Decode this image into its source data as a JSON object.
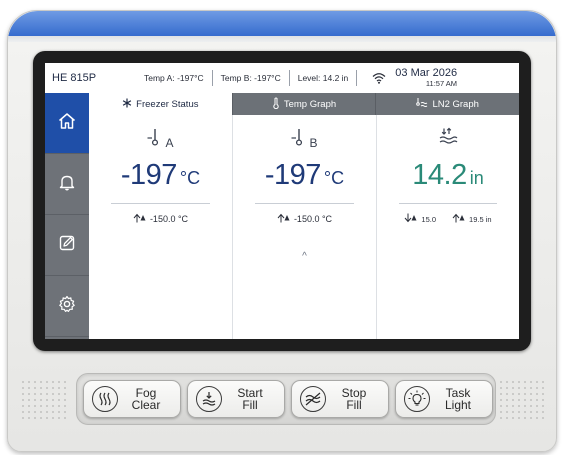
{
  "status_bar": {
    "model": "HE 815P",
    "temp_a": "Temp A: -197°C",
    "temp_b": "Temp B: -197°C",
    "level": "Level: 14.2 in",
    "date": "03 Mar 2026",
    "time": "11:57 AM"
  },
  "sidebar": {
    "items": [
      {
        "icon": "home-icon",
        "active": true
      },
      {
        "icon": "bell-icon",
        "active": false
      },
      {
        "icon": "edit-icon",
        "active": false
      },
      {
        "icon": "gear-icon",
        "active": false
      }
    ]
  },
  "tabs": [
    {
      "label": "Freezer Status",
      "icon": "snowflake-icon",
      "active": true
    },
    {
      "label": "Temp Graph",
      "icon": "thermometer-icon",
      "active": false
    },
    {
      "label": "LN2 Graph",
      "icon": "ln2-level-icon",
      "active": false
    }
  ],
  "panels": {
    "temp_a": {
      "sensor": "A",
      "value": "-197",
      "unit": "°C",
      "alarm_setpoint": "-150.0 °C"
    },
    "temp_b": {
      "sensor": "B",
      "value": "-197",
      "unit": "°C",
      "alarm_setpoint": "-150.0 °C"
    },
    "level": {
      "value": "14.2",
      "unit": "in",
      "low_setpoint": "15.0",
      "high_setpoint": "19.5 in"
    }
  },
  "hardware_buttons": [
    {
      "line1": "Fog",
      "line2": "Clear",
      "icon": "fog-clear-icon"
    },
    {
      "line1": "Start",
      "line2": "Fill",
      "icon": "start-fill-icon"
    },
    {
      "line1": "Stop",
      "line2": "Fill",
      "icon": "stop-fill-icon"
    },
    {
      "line1": "Task",
      "line2": "Light",
      "icon": "task-light-icon"
    }
  ],
  "colors": {
    "accent_blue": "#1f4fa8",
    "value_blue": "#1f3a78",
    "level_green": "#2a8a78",
    "sidebar_gray": "#6e7278"
  }
}
